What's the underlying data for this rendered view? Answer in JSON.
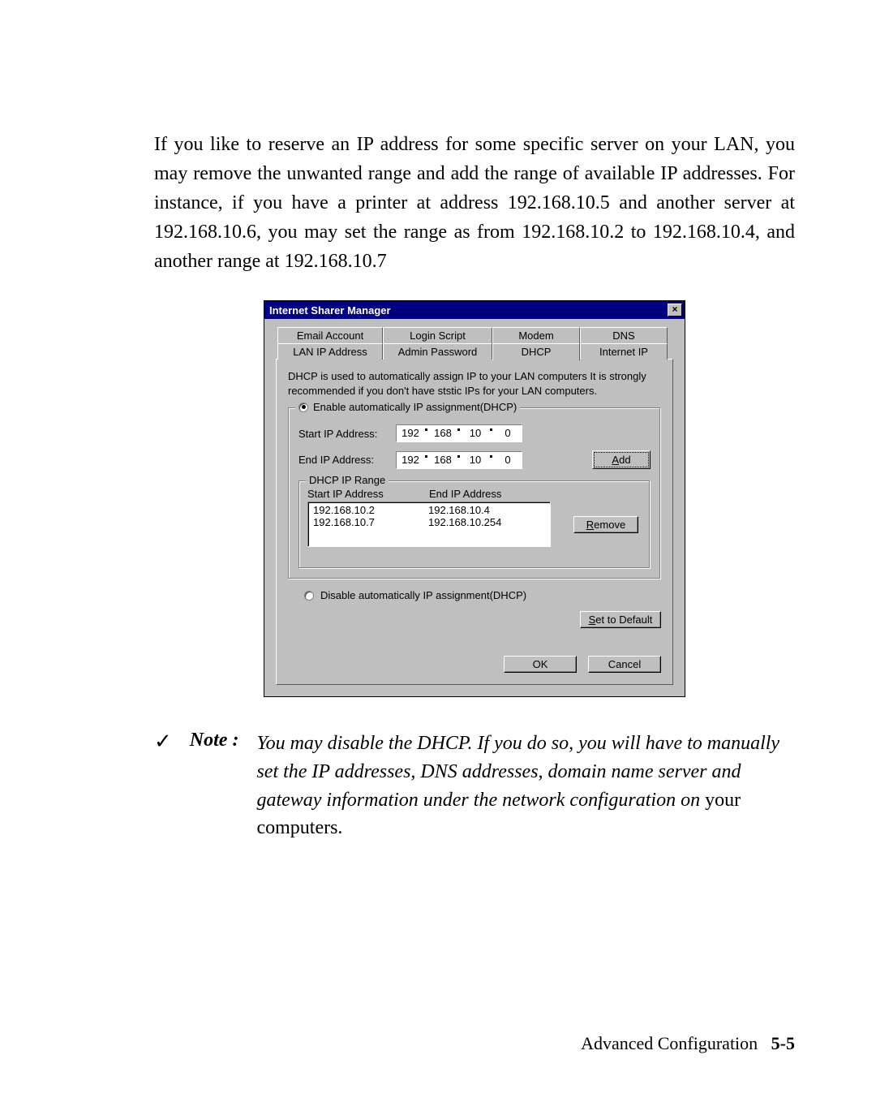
{
  "paragraph": "If you like to reserve an IP address for some specific server on your LAN, you may remove the unwanted range and add the range of available IP addresses. For instance, if you have a printer at address 192.168.10.5 and another server at 192.168.10.6, you may set the range as from 192.168.10.2 to 192.168.10.4, and another range at 192.168.10.7",
  "dialog": {
    "title": "Internet Sharer Manager",
    "tabs_back": [
      "Email Account",
      "Login Script",
      "Modem",
      "DNS"
    ],
    "tabs_front": [
      "LAN IP Address",
      "Admin Password",
      "DHCP",
      "Internet IP"
    ],
    "selected_tab": "DHCP",
    "description": "DHCP is used to automatically assign IP to your LAN computers It is strongly recommended if you don't have ststic IPs for your LAN computers.",
    "enable_label": "Enable automatically IP assignment(DHCP)",
    "start_label": "Start IP Address:",
    "end_label": "End IP Address:",
    "start_ip": [
      "192",
      "168",
      "10",
      "0"
    ],
    "end_ip": [
      "192",
      "168",
      "10",
      "0"
    ],
    "add_label": "Add",
    "range_group_label": "DHCP IP Range",
    "col1": "Start IP Address",
    "col2": "End IP Address",
    "ranges": [
      {
        "start": "192.168.10.2",
        "end": "192.168.10.4"
      },
      {
        "start": "192.168.10.7",
        "end": "192.168.10.254"
      }
    ],
    "remove_label": "Remove",
    "disable_label": "Disable automatically IP assignment(DHCP)",
    "default_label": "Set to Default",
    "ok_label": "OK",
    "cancel_label": "Cancel"
  },
  "note": {
    "label": "Note :",
    "italic": "You may disable the DHCP. If you do so, you will have to manually set the IP addresses, DNS addresses, domain name server and gateway information under the network configuration on ",
    "plain": "your computers."
  },
  "footer": {
    "section": "Advanced Configuration",
    "page": "5-5"
  }
}
